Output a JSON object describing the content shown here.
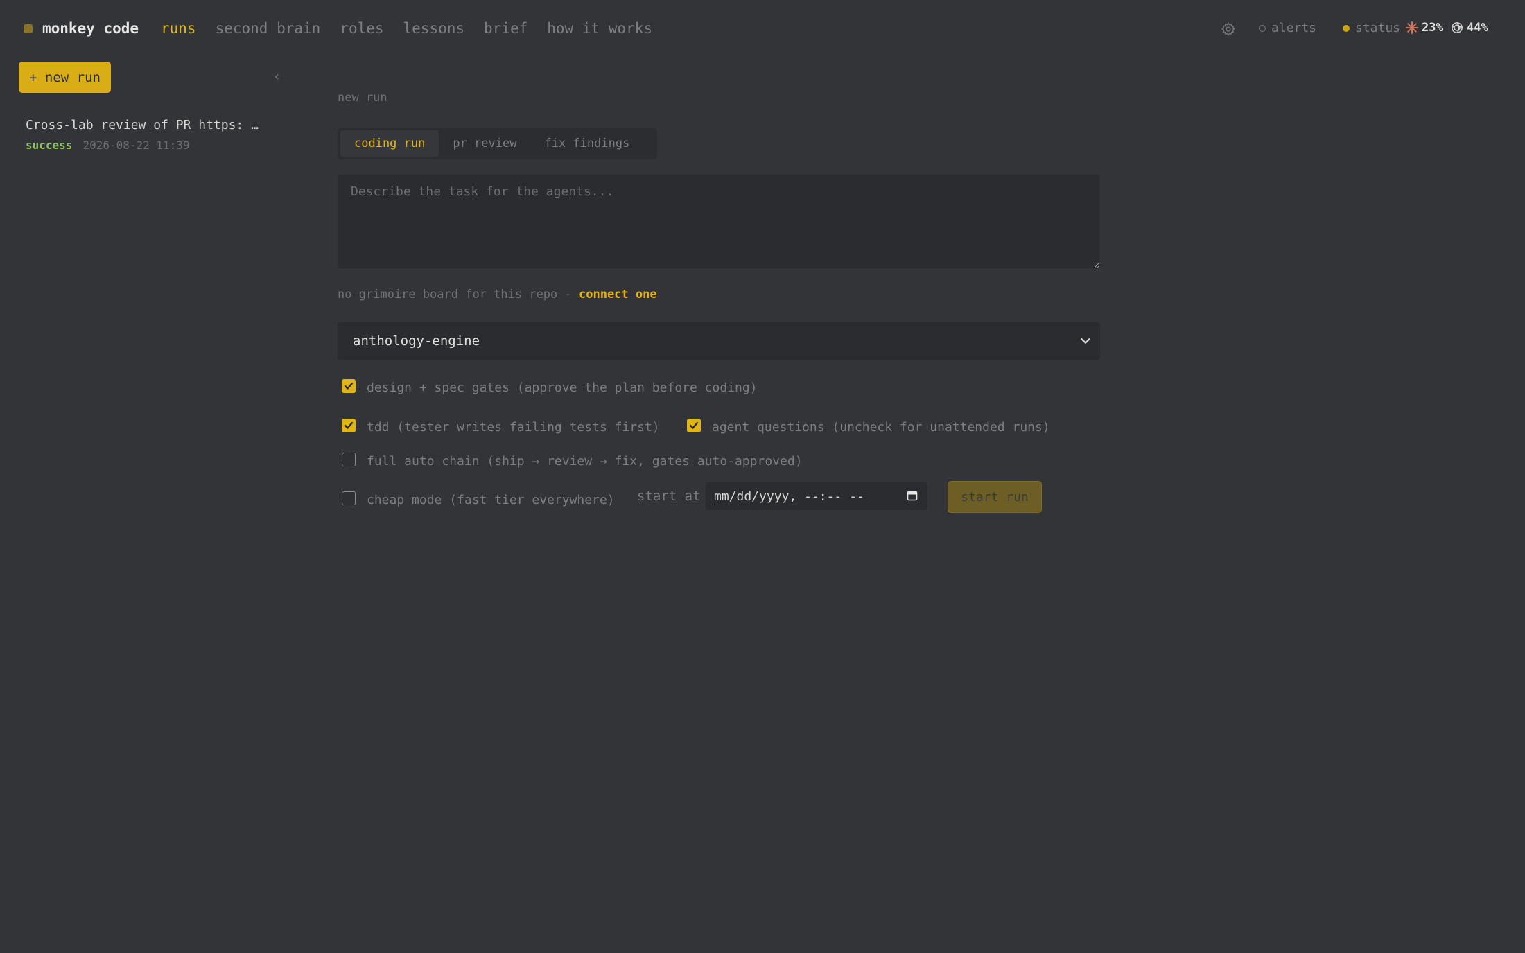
{
  "app": {
    "name": "monkey code",
    "brand_color": "#e2b517"
  },
  "nav": [
    {
      "label": "runs",
      "active": true
    },
    {
      "label": "second brain"
    },
    {
      "label": "roles"
    },
    {
      "label": "lessons"
    },
    {
      "label": "brief"
    },
    {
      "label": "how it works"
    }
  ],
  "header": {
    "settings_icon": "gear-icon",
    "alerts_label": "alerts",
    "status_label": "status",
    "usage": [
      {
        "icon": "sparkle-icon",
        "value": "23%",
        "color": "#e07a5f"
      },
      {
        "icon": "swirl-icon",
        "value": "44%",
        "color": "#d6d6d6"
      }
    ]
  },
  "sidebar": {
    "new_run_label": "+ new run",
    "collapse_icon": "chevron-left-icon",
    "collapse_glyph": "‹",
    "runs": [
      {
        "title": "Cross-lab review of PR https: …",
        "status": "success",
        "time": "2026-08-22 11:39",
        "status_color": "#8fc262"
      }
    ]
  },
  "main": {
    "section_label": "new run",
    "tabs": [
      {
        "label": "coding run",
        "active": true
      },
      {
        "label": "pr review"
      },
      {
        "label": "fix findings"
      }
    ],
    "task_placeholder": "Describe the task for the agents...",
    "grimoire_text": "no grimoire board for this repo - ",
    "grimoire_link": "connect one",
    "repo_selected": "anthology-engine",
    "options": {
      "design_gates": {
        "label": "design + spec gates (approve the plan before coding)",
        "checked": true
      },
      "tdd": {
        "label": "tdd (tester writes failing tests first)",
        "checked": true
      },
      "agent_questions": {
        "label": "agent questions (uncheck for unattended runs)",
        "checked": true
      },
      "full_auto": {
        "label": "full auto chain (ship → review → fix, gates auto-approved)",
        "checked": false
      },
      "cheap_mode": {
        "label": "cheap mode (fast tier everywhere)",
        "checked": false
      }
    },
    "start_at_label": "start at",
    "start_at_placeholder": "mm/dd/yyyy, --:-- --",
    "start_button_label": "start run"
  }
}
